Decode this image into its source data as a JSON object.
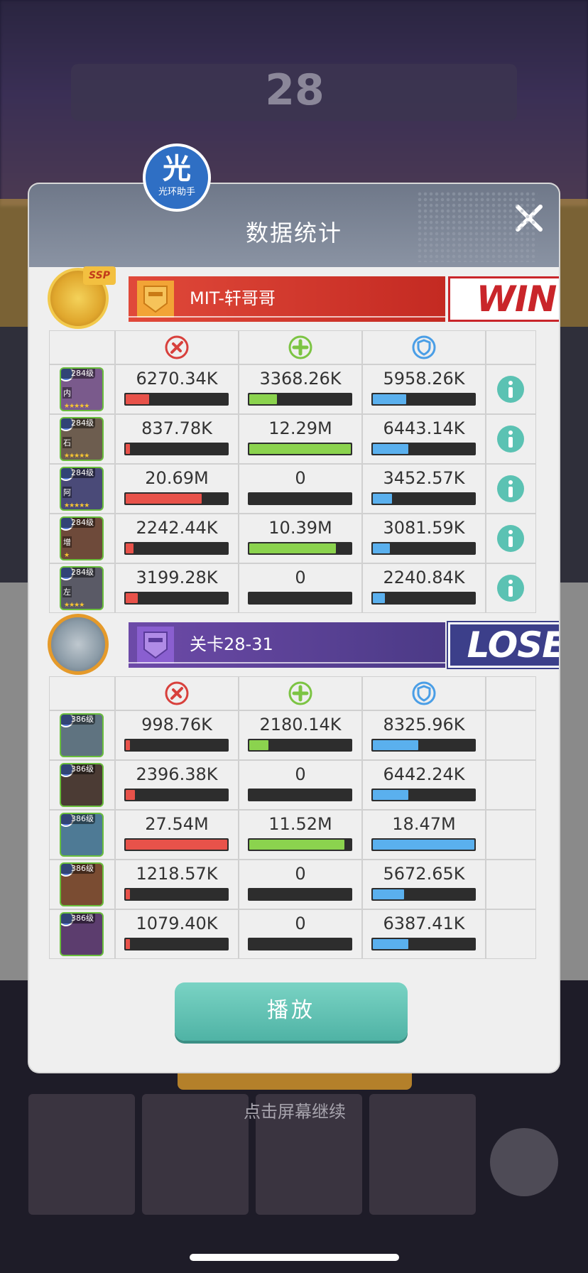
{
  "background": {
    "score": "28",
    "tap_hint": "点击屏幕继续"
  },
  "dialog": {
    "title": "数据统计",
    "logo_glyph": "光",
    "logo_text": "光环助手",
    "play_label": "播放"
  },
  "colors": {
    "damage": "#e8524a",
    "heal": "#8bd34e",
    "defense": "#5ab0ee",
    "win": "#c9252a",
    "lose": "#3c3f8a",
    "play_button": "#5fc1b3"
  },
  "stat_icons": [
    "damage-icon",
    "heal-icon",
    "shield-icon"
  ],
  "teams": [
    {
      "name": "MIT-轩哥哥",
      "result": "WIN",
      "badge": "SSP",
      "heroes": [
        {
          "level": "284级",
          "position": "内",
          "stars": "★★★★★",
          "damage": "6270.34K",
          "heal": "3368.26K",
          "defense": "5958.26K",
          "damage_pct": 0.23,
          "heal_pct": 0.27,
          "defense_pct": 0.33,
          "has_info": true
        },
        {
          "level": "284级",
          "position": "石",
          "stars": "★★★★★",
          "damage": "837.78K",
          "heal": "12.29M",
          "defense": "6443.14K",
          "damage_pct": 0.04,
          "heal_pct": 1.0,
          "defense_pct": 0.35,
          "has_info": true
        },
        {
          "level": "284级",
          "position": "阿",
          "stars": "★★★★★",
          "damage": "20.69M",
          "heal": "0",
          "defense": "3452.57K",
          "damage_pct": 0.75,
          "heal_pct": 0,
          "defense_pct": 0.19,
          "has_info": true
        },
        {
          "level": "284级",
          "position": "增",
          "stars": "★",
          "damage": "2242.44K",
          "heal": "10.39M",
          "defense": "3081.59K",
          "damage_pct": 0.08,
          "heal_pct": 0.85,
          "defense_pct": 0.17,
          "has_info": true
        },
        {
          "level": "284级",
          "position": "左",
          "stars": "★★★★",
          "damage": "3199.28K",
          "heal": "0",
          "defense": "2240.84K",
          "damage_pct": 0.12,
          "heal_pct": 0,
          "defense_pct": 0.12,
          "has_info": true
        }
      ]
    },
    {
      "name": "关卡28-31",
      "result": "LOSE",
      "heroes": [
        {
          "level": "386级",
          "damage": "998.76K",
          "heal": "2180.14K",
          "defense": "8325.96K",
          "damage_pct": 0.04,
          "heal_pct": 0.19,
          "defense_pct": 0.45,
          "has_info": false
        },
        {
          "level": "386级",
          "damage": "2396.38K",
          "heal": "0",
          "defense": "6442.24K",
          "damage_pct": 0.09,
          "heal_pct": 0,
          "defense_pct": 0.35,
          "has_info": false
        },
        {
          "level": "386级",
          "damage": "27.54M",
          "heal": "11.52M",
          "defense": "18.47M",
          "damage_pct": 1.0,
          "heal_pct": 0.94,
          "defense_pct": 1.0,
          "has_info": false
        },
        {
          "level": "386级",
          "damage": "1218.57K",
          "heal": "0",
          "defense": "5672.65K",
          "damage_pct": 0.04,
          "heal_pct": 0,
          "defense_pct": 0.31,
          "has_info": false
        },
        {
          "level": "386级",
          "damage": "1079.40K",
          "heal": "0",
          "defense": "6387.41K",
          "damage_pct": 0.04,
          "heal_pct": 0,
          "defense_pct": 0.35,
          "has_info": false
        }
      ]
    }
  ]
}
